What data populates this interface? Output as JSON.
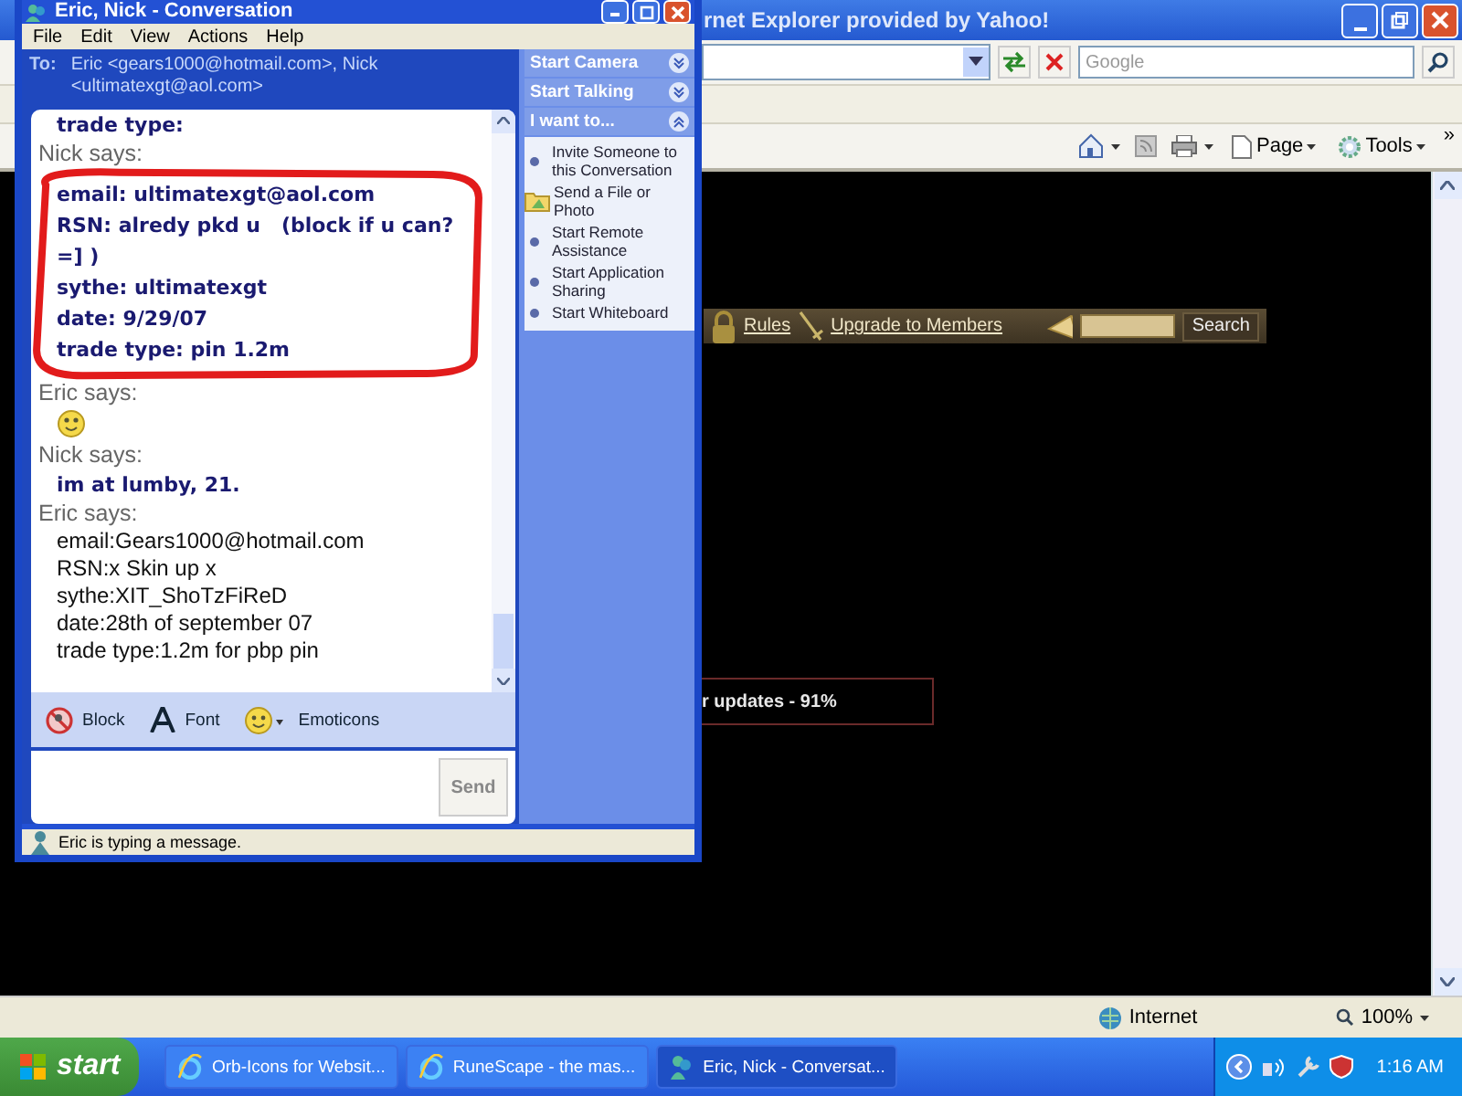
{
  "browser": {
    "title": "rnet Explorer provided by Yahoo!",
    "search_placeholder": "Google",
    "toolbar": [
      {
        "kind": "home"
      },
      {
        "kind": "feed"
      },
      {
        "kind": "print"
      },
      {
        "kind": "page",
        "label": "Page"
      },
      {
        "kind": "tools",
        "label": "Tools"
      }
    ],
    "more": "»",
    "page": {
      "links": [
        {
          "kind": "lock",
          "label": "Rules"
        },
        {
          "kind": "sword",
          "label": "Upgrade to Members"
        }
      ],
      "search_button": "Search",
      "loading_text": "r updates - 91%"
    },
    "status_bar": {
      "zone": "Internet",
      "zoom": "100%"
    }
  },
  "messenger": {
    "title": "Eric, Nick - Conversation",
    "menu": [
      "File",
      "Edit",
      "View",
      "Actions",
      "Help"
    ],
    "to_label": "To:",
    "recipients": "Eric <gears1000@hotmail.com>, Nick <ultimatexgt@aol.com>",
    "messages": [
      {
        "kind": "handwritten",
        "lines": [
          "trade type:"
        ]
      },
      {
        "sender": "Nick says:",
        "kind": "handwritten",
        "annotated": true,
        "lines": [
          "email: ultimatexgt@aol.com",
          "RSN: alredy pkd u   (block if u can? =] )",
          "sythe: ultimatexgt",
          "date: 9/29/07",
          "trade type: pin 1.2m"
        ]
      },
      {
        "sender": "Eric says:",
        "kind": "emoticon"
      },
      {
        "sender": "Nick says:",
        "kind": "handwritten",
        "lines": [
          "im at lumby, 21."
        ]
      },
      {
        "sender": "Eric says:",
        "kind": "plain",
        "lines": [
          "email:Gears1000@hotmail.com",
          "RSN:x Skin up x",
          "sythe:XIT_ShoTzFiReD",
          "date:28th of september 07",
          "trade type:1.2m for pbp pin"
        ]
      }
    ],
    "side_pane": {
      "sections": [
        {
          "label": "Start Camera",
          "expanded": false
        },
        {
          "label": "Start Talking",
          "expanded": false
        },
        {
          "label": "I want to...",
          "expanded": true
        }
      ],
      "actions": [
        {
          "kind": "bullet",
          "label": "Invite Someone to this Conversation"
        },
        {
          "kind": "file",
          "label": "Send a File or Photo"
        },
        {
          "kind": "bullet",
          "label": "Start Remote Assistance"
        },
        {
          "kind": "bullet",
          "label": "Start Application Sharing"
        },
        {
          "kind": "bullet",
          "label": "Start Whiteboard"
        }
      ]
    },
    "toolbar": [
      {
        "kind": "block",
        "label": "Block"
      },
      {
        "kind": "font",
        "label": "Font"
      },
      {
        "kind": "emoticons",
        "label": "Emoticons"
      }
    ],
    "send_button": "Send",
    "status": "Eric is typing a message."
  },
  "taskbar": {
    "start": "start",
    "tasks": [
      {
        "kind": "ie",
        "label": "Orb-Icons for Websit...",
        "selected": false
      },
      {
        "kind": "ie",
        "label": "RuneScape - the mas...",
        "selected": false
      },
      {
        "kind": "messenger",
        "label": "Eric, Nick - Conversat...",
        "selected": true
      }
    ],
    "clock": "1:16 AM"
  }
}
